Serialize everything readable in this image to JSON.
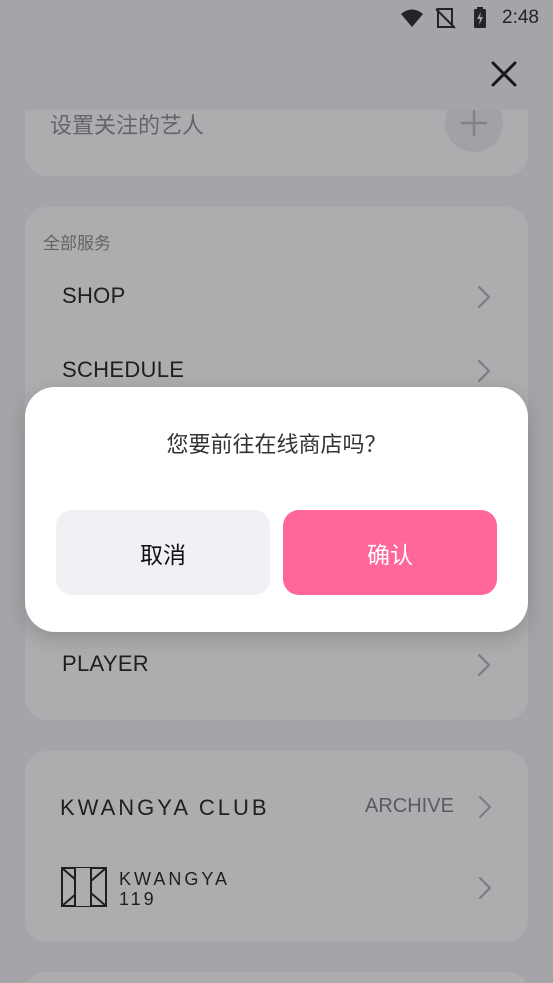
{
  "status_bar": {
    "time": "2:48",
    "icons": [
      "wifi-icon",
      "no-signal-icon",
      "battery-charging-icon"
    ]
  },
  "header": {
    "close_icon": "close-icon"
  },
  "follow_card": {
    "label": "设置关注的艺人",
    "add_icon": "plus-icon"
  },
  "services": {
    "section_label": "全部服务",
    "items": [
      {
        "label": "SHOP"
      },
      {
        "label": "SCHEDULE"
      },
      {
        "label": "PLAYER"
      }
    ]
  },
  "club": {
    "logo_text": "KWANGYA CLUB",
    "archive_label": "ARCHIVE",
    "k119_line1": "KWANGYA",
    "k119_line2": "119"
  },
  "dialog": {
    "message": "您要前往在线商店吗？",
    "cancel_label": "取消",
    "confirm_label": "确认"
  },
  "colors": {
    "accent": "#ff6699",
    "overlay": "rgba(40,40,46,0.38)"
  }
}
